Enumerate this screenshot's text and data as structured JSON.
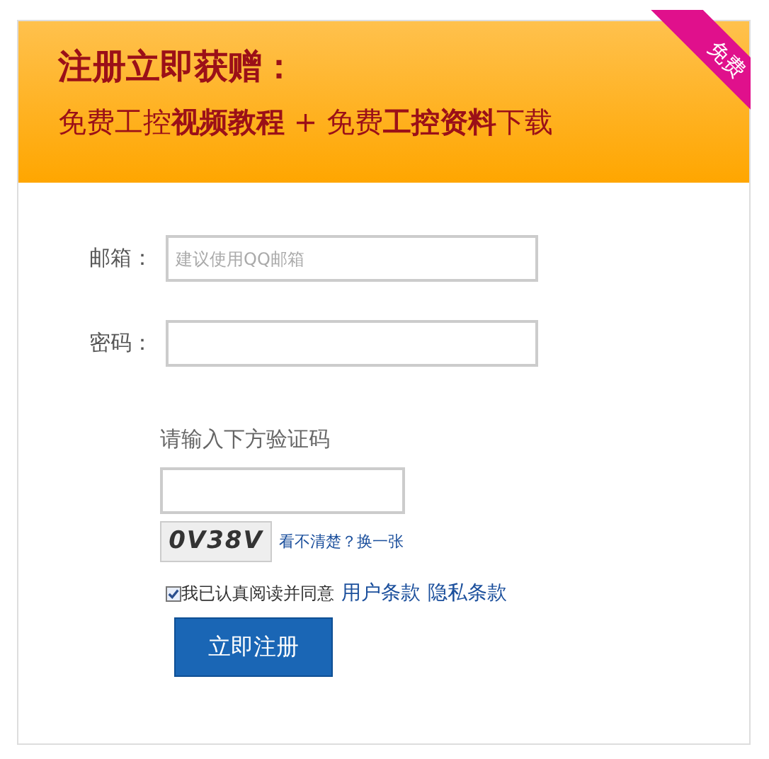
{
  "banner": {
    "headline": "注册立即获赠：",
    "subline": "免费工控**视频教程** + 免费**工控资料**下载",
    "ribbon": "免费"
  },
  "form": {
    "email": {
      "label": "邮箱：",
      "placeholder": "建议使用QQ邮箱"
    },
    "password": {
      "label": "密码："
    },
    "captcha": {
      "prompt": "请输入下方验证码",
      "code": "0V38V",
      "refresh_link": "看不清楚？换一张"
    },
    "agreement": {
      "checked": true,
      "text": "我已认真阅读并同意",
      "links": [
        "用户条款",
        "隐私条款"
      ]
    },
    "submit": "立即注册"
  }
}
